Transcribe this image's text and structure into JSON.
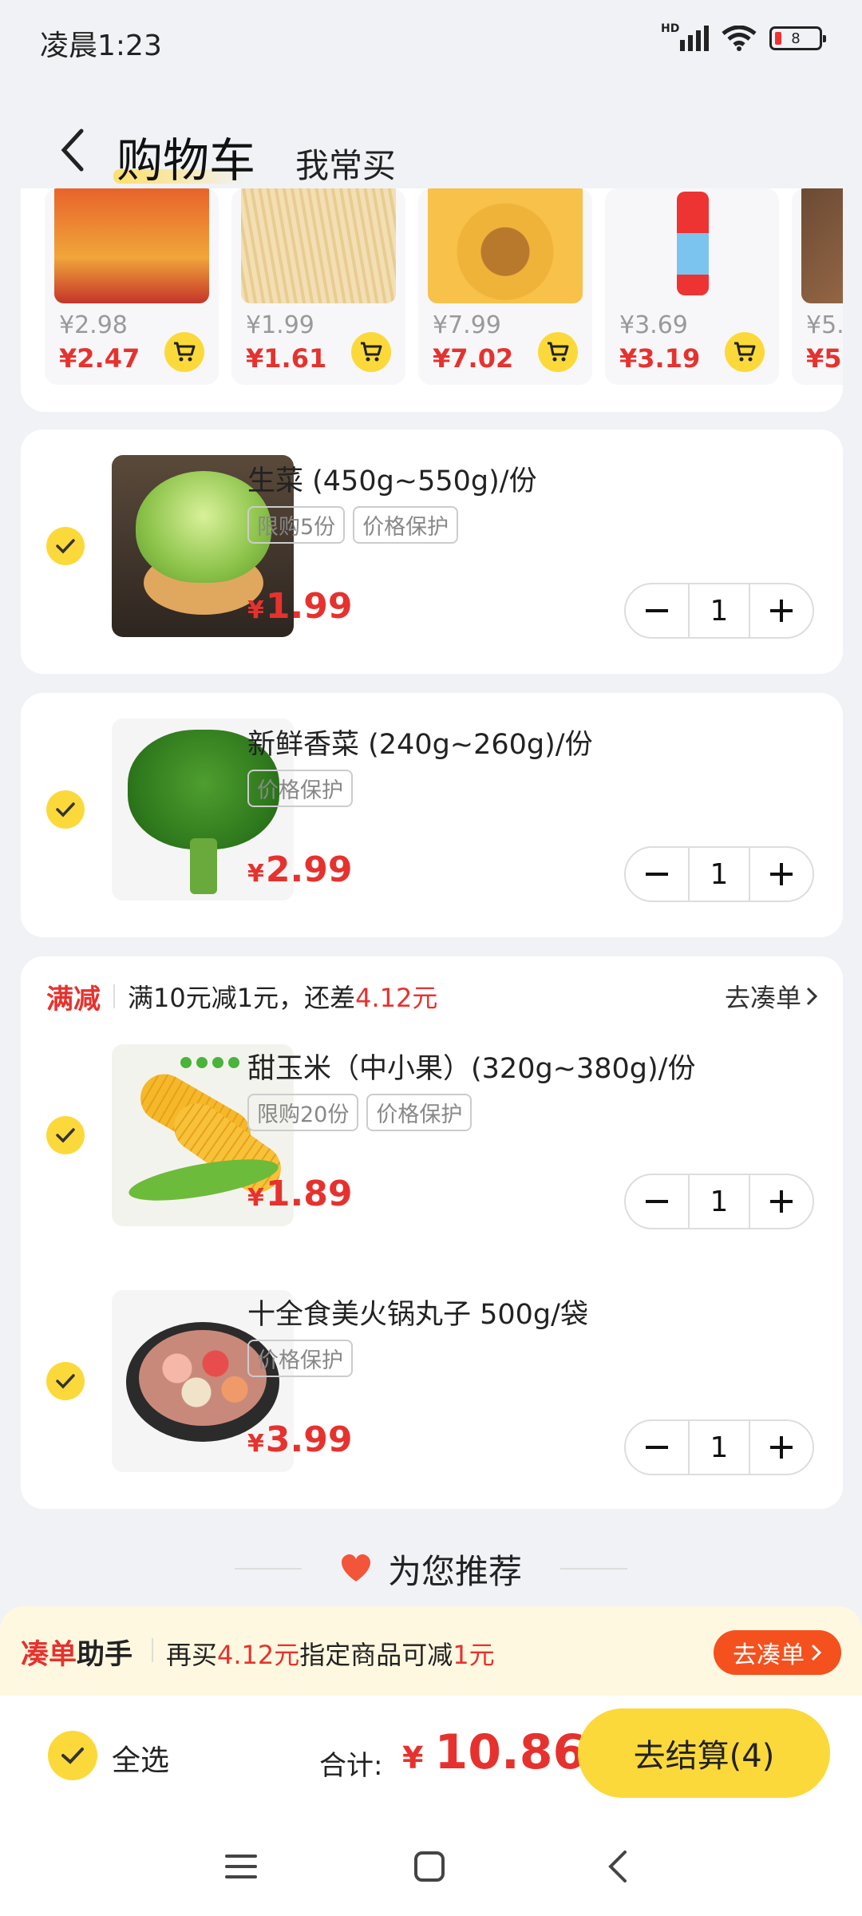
{
  "status": {
    "time": "凌晨1:23",
    "battery": "8",
    "network": "HD"
  },
  "header": {
    "title": "购物车",
    "tab_frequent": "我常买"
  },
  "frequent_items": [
    {
      "original_price": "¥2.98",
      "price": "¥2.47",
      "image": "luosifen-pack"
    },
    {
      "original_price": "¥1.99",
      "price": "¥1.61",
      "image": "noodles"
    },
    {
      "original_price": "¥7.99",
      "price": "¥7.02",
      "image": "instant-noodle-pack"
    },
    {
      "original_price": "¥3.69",
      "price": "¥3.19",
      "image": "iced-tea-can"
    },
    {
      "original_price": "¥5.",
      "price": "¥5.",
      "image": "snack"
    }
  ],
  "cart": {
    "items": [
      {
        "name": "生菜 (450g~550g)/份",
        "tags": [
          "限购5份",
          "价格保护"
        ],
        "currency": "¥",
        "price": "1.99",
        "qty": "1",
        "image": "lettuce"
      },
      {
        "name": "新鲜香菜 (240g~260g)/份",
        "tags": [
          "价格保护"
        ],
        "currency": "¥",
        "price": "2.99",
        "qty": "1",
        "image": "coriander"
      }
    ],
    "promo_group": {
      "tag": "满减",
      "text_prefix": "满10元减1元，还差",
      "text_amount": "4.12元",
      "link": "去凑单",
      "items": [
        {
          "name": "甜玉米（中小果）(320g~380g)/份",
          "tags": [
            "限购20份",
            "价格保护"
          ],
          "currency": "¥",
          "price": "1.89",
          "qty": "1",
          "image": "corn"
        },
        {
          "name": "十全食美火锅丸子 500g/袋",
          "tags": [
            "价格保护"
          ],
          "currency": "¥",
          "price": "3.99",
          "qty": "1",
          "image": "hotpot-balls"
        }
      ]
    }
  },
  "recommend": {
    "title": "为您推荐"
  },
  "helper": {
    "name_red": "凑单",
    "name_black": "助手",
    "text_1": "再买",
    "amount": "4.12元",
    "text_2": "指定商品可减",
    "discount": "1元",
    "button": "去凑单"
  },
  "checkout": {
    "select_all": "全选",
    "total_label": "合计:",
    "currency": "¥",
    "total": "10.86",
    "button": "去结算(4)"
  },
  "colors": {
    "accent": "#fcd93a",
    "price": "#e6322e",
    "cta": "#f4511e"
  }
}
